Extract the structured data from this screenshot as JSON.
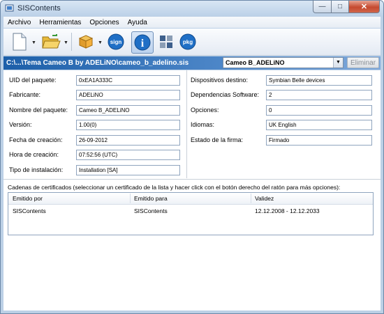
{
  "window": {
    "title": "SISContents"
  },
  "menu": {
    "items": [
      "Archivo",
      "Herramientas",
      "Opciones",
      "Ayuda"
    ]
  },
  "toolbar": {
    "sign_label": "sign",
    "info_label": "i",
    "pkg_label": "pkg"
  },
  "path_bar": {
    "path": "C:\\...\\Tema Cameo B by ADELiNO\\cameo_b_adelino.sis",
    "selected_component": "Cameo B_ADELiNO",
    "remove_label": "Eliminar"
  },
  "left_fields": [
    {
      "label": "UID del paquete:",
      "value": "0xEA1A333C"
    },
    {
      "label": "Fabricante:",
      "value": "ADELiNO"
    },
    {
      "label": "Nombre del paquete:",
      "value": "Cameo B_ADELiNO"
    },
    {
      "label": "Versión:",
      "value": "1.00(0)"
    },
    {
      "label": "Fecha de creación:",
      "value": "26-09-2012"
    },
    {
      "label": "Hora de creación:",
      "value": "07:52:56 (UTC)"
    },
    {
      "label": "Tipo de instalación:",
      "value": "Installation [SA]"
    }
  ],
  "right_fields": [
    {
      "label": "Dispositivos destino:",
      "value": "Symbian Belle devices"
    },
    {
      "label": "Dependencias Software:",
      "value": "2"
    },
    {
      "label": "Opciones:",
      "value": "0"
    },
    {
      "label": "Idiomas:",
      "value": "UK English"
    },
    {
      "label": "Estado de la firma:",
      "value": "Firmado"
    }
  ],
  "certificates": {
    "caption": "Cadenas de certificados (seleccionar un certificado de la lista y hacer click con el botón derecho del ratón para más opciones):",
    "columns": [
      "Emitido por",
      "Emitido para",
      "Validez"
    ],
    "rows": [
      [
        "SISContents",
        "SISContents",
        "12.12.2008 - 12.12.2033"
      ]
    ]
  },
  "colors": {
    "path_bar": "#1d5fa9",
    "field_border": "#8fa4be",
    "close_button": "#c5492f"
  }
}
